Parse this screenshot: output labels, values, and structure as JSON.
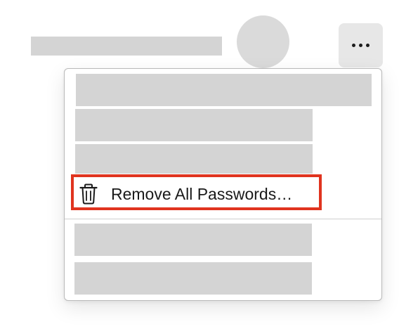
{
  "header": {
    "more_button_icon": "ellipsis-icon"
  },
  "menu": {
    "remove_all": {
      "label": "Remove All Passwords…",
      "icon": "trash-icon",
      "highlight_color": "#e0341f"
    }
  },
  "colors": {
    "placeholder": "#d4d4d4",
    "menu_border": "#b9b9b9"
  }
}
